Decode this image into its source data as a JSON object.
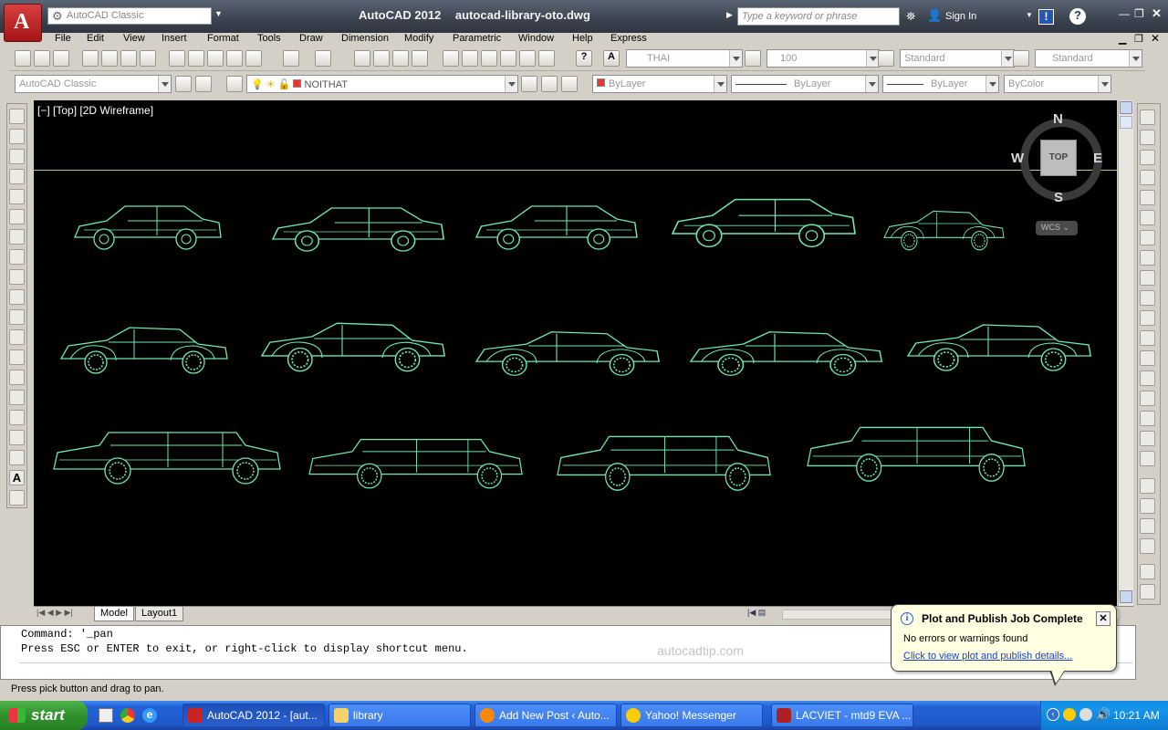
{
  "title": {
    "app": "AutoCAD 2012",
    "file": "autocad-library-oto.dwg"
  },
  "workspace_top": "AutoCAD Classic",
  "search": {
    "placeholder": "Type a keyword or phrase"
  },
  "signin": "Sign In",
  "menu": [
    "File",
    "Edit",
    "View",
    "Insert",
    "Format",
    "Tools",
    "Draw",
    "Dimension",
    "Modify",
    "Parametric",
    "Window",
    "Help",
    "Express"
  ],
  "toolbar": {
    "text_style": "THAI",
    "text_height": "100",
    "dim_style": "Standard",
    "table_style": "Standard",
    "workspace": "AutoCAD Classic",
    "layer": "NOITHAT",
    "color": "ByLayer",
    "linetype": "ByLayer",
    "lineweight": "ByLayer",
    "plotstyle": "ByColor"
  },
  "viewport": {
    "label": "[−] [Top] [2D Wireframe]",
    "compass": {
      "n": "N",
      "s": "S",
      "e": "E",
      "w": "W",
      "cube": "TOP",
      "wcs": "WCS"
    }
  },
  "tabs": [
    "Model",
    "Layout1"
  ],
  "command": {
    "line1": "Command: '_pan",
    "line2": "Press ESC or ENTER to exit, or right-click to display shortcut menu."
  },
  "watermark": "autocadtip.com",
  "status": "Press pick button and drag to pan.",
  "balloon": {
    "title": "Plot and Publish Job Complete",
    "message": "No errors or warnings found",
    "link": "Click to view plot and publish details..."
  },
  "taskbar": {
    "start": "start",
    "items": [
      "AutoCAD 2012 - [aut...",
      "library",
      "Add New Post ‹ Auto...",
      "Yahoo! Messenger",
      "LACVIET - mtd9 EVA ..."
    ],
    "clock": "10:21 AM"
  },
  "colors": {
    "car_lines": "#6ee8b0",
    "viewport_bg": "#000000",
    "taskbar": "#245edb"
  }
}
